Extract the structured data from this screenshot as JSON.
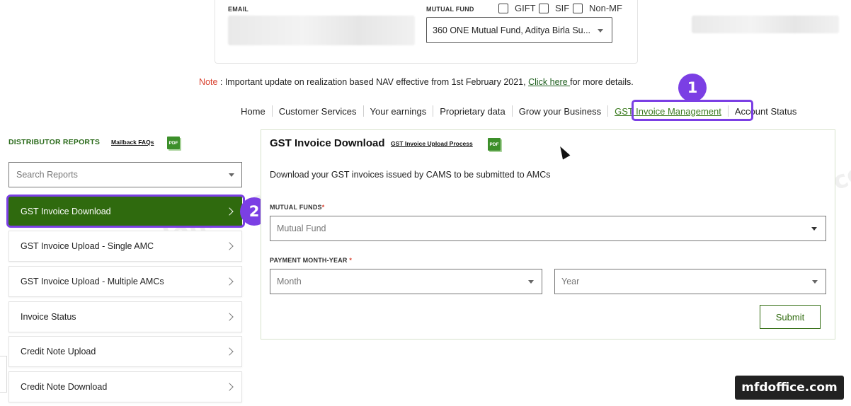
{
  "top_section": {
    "email_label": "EMAIL",
    "mutual_fund_label": "MUTUAL FUND",
    "checkboxes": [
      {
        "label": "GIFT",
        "checked": false
      },
      {
        "label": "SIF",
        "checked": false
      },
      {
        "label": "Non-MF",
        "checked": false
      }
    ],
    "mutual_fund_value": "360 ONE Mutual Fund, Aditya Birla Su..."
  },
  "note": {
    "prefix": "Note",
    "text": " : Important update on realization based NAV effective from 1st February 2021, ",
    "link": "Click here ",
    "suffix": "for more details."
  },
  "nav": {
    "items": [
      "Home",
      "Customer Services",
      "Your earnings",
      "Proprietary data",
      "Grow your Business",
      "GST Invoice Management",
      "Account Status"
    ],
    "active_index": 5
  },
  "annotations": {
    "step1": "1",
    "step2": "2",
    "highlight_color": "#7b3fe4"
  },
  "sidebar": {
    "title": "DISTRIBUTOR REPORTS",
    "faq_link": "Mailback FAQs",
    "pdf_label": "PDF",
    "search_placeholder": "Search Reports",
    "items": [
      {
        "label": "GST Invoice Download",
        "active": true
      },
      {
        "label": "GST Invoice Upload - Single AMC",
        "active": false
      },
      {
        "label": "GST Invoice Upload - Multiple AMCs",
        "active": false
      },
      {
        "label": "Invoice Status",
        "active": false
      },
      {
        "label": "Credit Note Upload",
        "active": false
      },
      {
        "label": "Credit Note Download",
        "active": false
      }
    ]
  },
  "panel": {
    "title": "GST Invoice Download",
    "process_link": "GST Invoice Upload Process",
    "description": "Download your GST invoices issued by CAMS to be submitted to AMCs",
    "mutual_funds_label": "MUTUAL FUNDS",
    "mutual_funds_placeholder": "Mutual Fund",
    "payment_label": "PAYMENT MONTH-YEAR",
    "required_mark": "*",
    "month_placeholder": "Month",
    "year_placeholder": "Year",
    "submit_label": "Submit"
  },
  "watermark": "mfdoffice.com",
  "brand": "mfdoffice.com",
  "colors": {
    "accent_green": "#2f6a0e",
    "note_red": "#d8412f",
    "annotation_purple": "#7b3fe4"
  }
}
